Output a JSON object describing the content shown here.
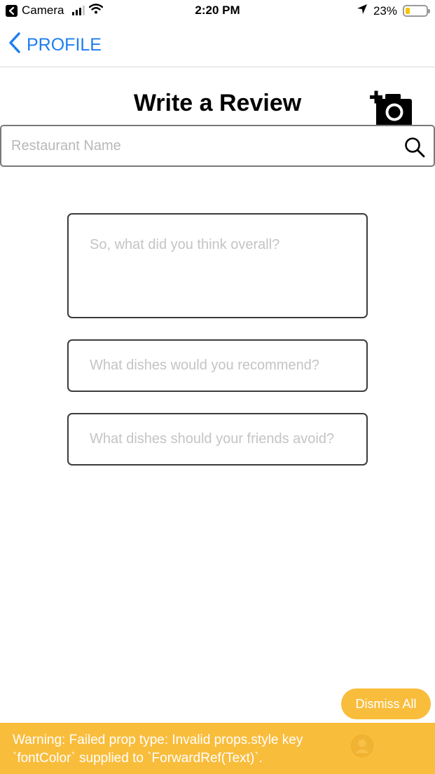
{
  "status_bar": {
    "back_app": "Camera",
    "time": "2:20 PM",
    "battery": "23%",
    "battery_level": 0.23,
    "battery_color": "#f5c400"
  },
  "nav": {
    "back_label": "PROFILE",
    "back_icon": "chevron-left-icon",
    "accent_color": "#1e7ef0"
  },
  "header": {
    "title": "Write a Review",
    "camera_icon": "add-photo-camera-icon"
  },
  "search": {
    "placeholder": "Restaurant Name",
    "value": "",
    "icon": "search-icon"
  },
  "review_form": {
    "overall_placeholder": "So, what did you think overall?",
    "recommend_placeholder": "What dishes would you recommend?",
    "avoid_placeholder": "What dishes should your friends avoid?"
  },
  "dev_warning": {
    "dismiss_label": "Dismiss All",
    "message": "Warning: Failed prop type: Invalid props.style key\n`fontColor` supplied to `ForwardRef(Text)`.",
    "banner_color": "#f9bd3c"
  }
}
